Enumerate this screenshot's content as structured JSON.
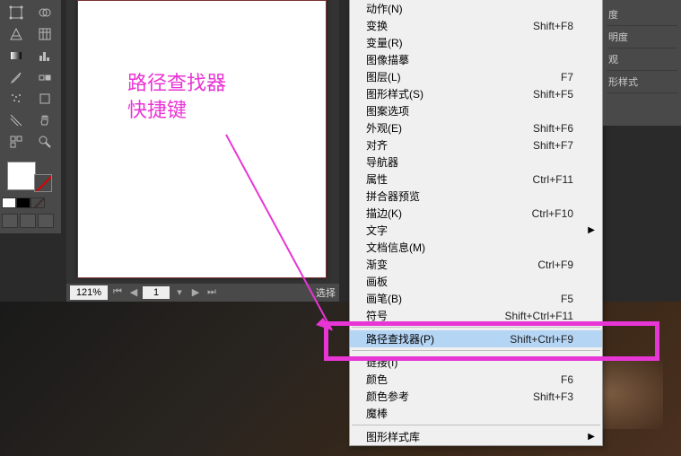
{
  "colors": {
    "highlight": "#e835d5",
    "menu_bg": "#f0f0f0",
    "menu_hover": "#b5d5f5"
  },
  "annotation": {
    "line1": "路径查找器",
    "line2": "快捷键"
  },
  "statusbar": {
    "zoom": "121%",
    "page": "1",
    "right_text": "选择"
  },
  "right_panel": {
    "items": [
      "度",
      "明度",
      "观",
      "形样式"
    ]
  },
  "menu": {
    "items": [
      {
        "label": "动作(N)",
        "shortcut": ""
      },
      {
        "label": "变换",
        "shortcut": "Shift+F8"
      },
      {
        "label": "变量(R)",
        "shortcut": ""
      },
      {
        "label": "图像描摹",
        "shortcut": ""
      },
      {
        "label": "图层(L)",
        "shortcut": "F7"
      },
      {
        "label": "图形样式(S)",
        "shortcut": "Shift+F5"
      },
      {
        "label": "图案选项",
        "shortcut": ""
      },
      {
        "label": "外观(E)",
        "shortcut": "Shift+F6"
      },
      {
        "label": "对齐",
        "shortcut": "Shift+F7"
      },
      {
        "label": "导航器",
        "shortcut": ""
      },
      {
        "label": "属性",
        "shortcut": "Ctrl+F11"
      },
      {
        "label": "拼合器预览",
        "shortcut": ""
      },
      {
        "label": "描边(K)",
        "shortcut": "Ctrl+F10"
      },
      {
        "label": "文字",
        "shortcut": "",
        "submenu": true
      },
      {
        "label": "文档信息(M)",
        "shortcut": ""
      },
      {
        "label": "渐变",
        "shortcut": "Ctrl+F9"
      },
      {
        "label": "画板",
        "shortcut": ""
      },
      {
        "label": "画笔(B)",
        "shortcut": "F5"
      },
      {
        "label": "符号",
        "shortcut": "Shift+Ctrl+F11"
      },
      {
        "sep": true
      },
      {
        "label": "路径查找器(P)",
        "shortcut": "Shift+Ctrl+F9",
        "highlighted": true
      },
      {
        "sep": true
      },
      {
        "label": "链接(I)",
        "shortcut": ""
      },
      {
        "label": "颜色",
        "shortcut": "F6"
      },
      {
        "label": "颜色参考",
        "shortcut": "Shift+F3"
      },
      {
        "label": "魔棒",
        "shortcut": ""
      },
      {
        "sep": true
      },
      {
        "label": "图形样式库",
        "shortcut": "",
        "submenu": true
      }
    ]
  }
}
